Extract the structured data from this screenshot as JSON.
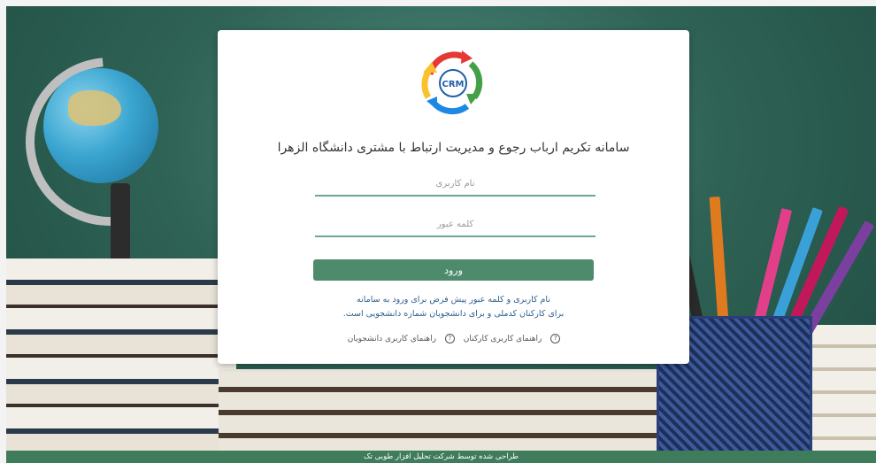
{
  "login": {
    "title": "سامانه تکریم ارباب رجوع و مدیریت ارتباط با مشتری دانشگاه الزهرا",
    "username_placeholder": "نام کاربری",
    "password_placeholder": "کلمه عبور",
    "login_label": "ورود",
    "note_line1": "نام کاربری و کلمه عبور پیش فرض برای ورود به سامانه",
    "note_line2": "برای کارکنان کدملی و برای دانشجویان شماره دانشجویی است.",
    "help_staff": "راهنمای کاربری کارکنان",
    "help_students": "راهنمای کاربری دانشجویان",
    "logo_text": "CRM"
  },
  "footer": {
    "text": "طراحی شده توسط شرکت تحلیل افزار طوبی تک"
  },
  "colors": {
    "accent": "#4e8a6c",
    "note": "#2b5e8e",
    "footer": "#3f7c5b"
  }
}
